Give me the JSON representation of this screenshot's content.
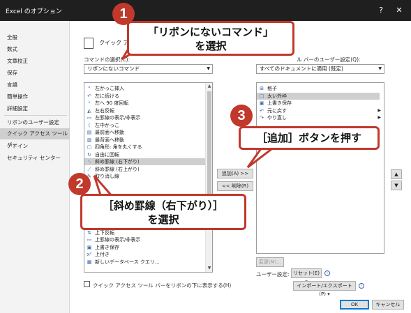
{
  "window": {
    "title": "Excel のオプション",
    "help_glyph": "?",
    "close_glyph": "✕"
  },
  "sidebar": {
    "items": [
      "全般",
      "数式",
      "文章校正",
      "保存",
      "言語",
      "簡単操作",
      "詳細設定",
      "リボンのユーザー設定",
      "クイック アクセス ツール バー",
      "アドイン",
      "セキュリティ センター"
    ],
    "selected_index": 8
  },
  "main": {
    "header": "クイック アクセス",
    "left_label": "コマンドの選択(C):",
    "left_select": "リボンにないコマンド",
    "right_label": "ル バーのユーザー設定(Q):",
    "right_select": "すべてのドキュメントに適用 (既定)",
    "commands": [
      {
        "icon": "“",
        "label": "左かっこ挿入"
      },
      {
        "icon": "↶",
        "label": "左に続ける"
      },
      {
        "icon": "ᵃ",
        "label": "左へ 90 度回転"
      },
      {
        "icon": "◭",
        "label": "左右反転"
      },
      {
        "icon": "▭",
        "label": "左罫線の表示/非表示"
      },
      {
        "icon": "(",
        "label": "左中かっこ"
      },
      {
        "icon": "▤",
        "label": "最前面へ移動"
      },
      {
        "icon": "▥",
        "label": "最背面へ移動"
      },
      {
        "icon": "▢",
        "label": "四角形: 角を丸くする"
      },
      {
        "icon": "↻",
        "label": "自由に回転"
      },
      {
        "icon": "⟍",
        "label": "斜め罫線 (右下がり)"
      },
      {
        "icon": "⟋",
        "label": "斜め罫線 (右上がり)"
      },
      {
        "icon": "✎",
        "label": "取り消し線"
      },
      {
        "icon": "⇅",
        "label": "上下反転"
      },
      {
        "icon": "▭",
        "label": "上罫線の表示/非表示"
      },
      {
        "icon": "▣",
        "label": "上書き保存"
      },
      {
        "icon": "x²",
        "label": "上付き"
      },
      {
        "icon": "▦",
        "label": "新しいデータベース クエリ..."
      }
    ],
    "selected_command": 10,
    "qat": [
      {
        "icon": "⊞",
        "label": "格子"
      },
      {
        "icon": "□",
        "label": "太い外枠"
      },
      {
        "icon": "▣",
        "label": "上書き保存"
      },
      {
        "icon": "↶",
        "label": "元に戻す"
      },
      {
        "icon": "↷",
        "label": "やり直し"
      }
    ],
    "selected_qat": 1,
    "add_button": "追加(A) >>",
    "remove_button": "<< 削除(R)",
    "modify_button": "変更(M)...",
    "user_settings_label": "ユーザー設定:",
    "reset_button": "リセット(E) ▾",
    "import_export_button": "インポート/エクスポート(P) ▾",
    "checkbox_label": "クイック アクセス ツール バーをリボンの下に表示する(H)",
    "ok": "OK",
    "cancel": "キャンセル",
    "up_glyph": "▲",
    "down_glyph": "▼"
  },
  "callouts": {
    "c1": {
      "num": "1",
      "line1": "「リボンにないコマンド」",
      "line2": "を選択"
    },
    "c2": {
      "num": "2",
      "line1": "［斜め罫線（右下がり）］",
      "line2": "を選択"
    },
    "c3": {
      "num": "3",
      "line1": "［追加］ボタンを押す"
    }
  },
  "colors": {
    "accent_red": "#c0392b",
    "title_bg": "#1f1f1f"
  }
}
